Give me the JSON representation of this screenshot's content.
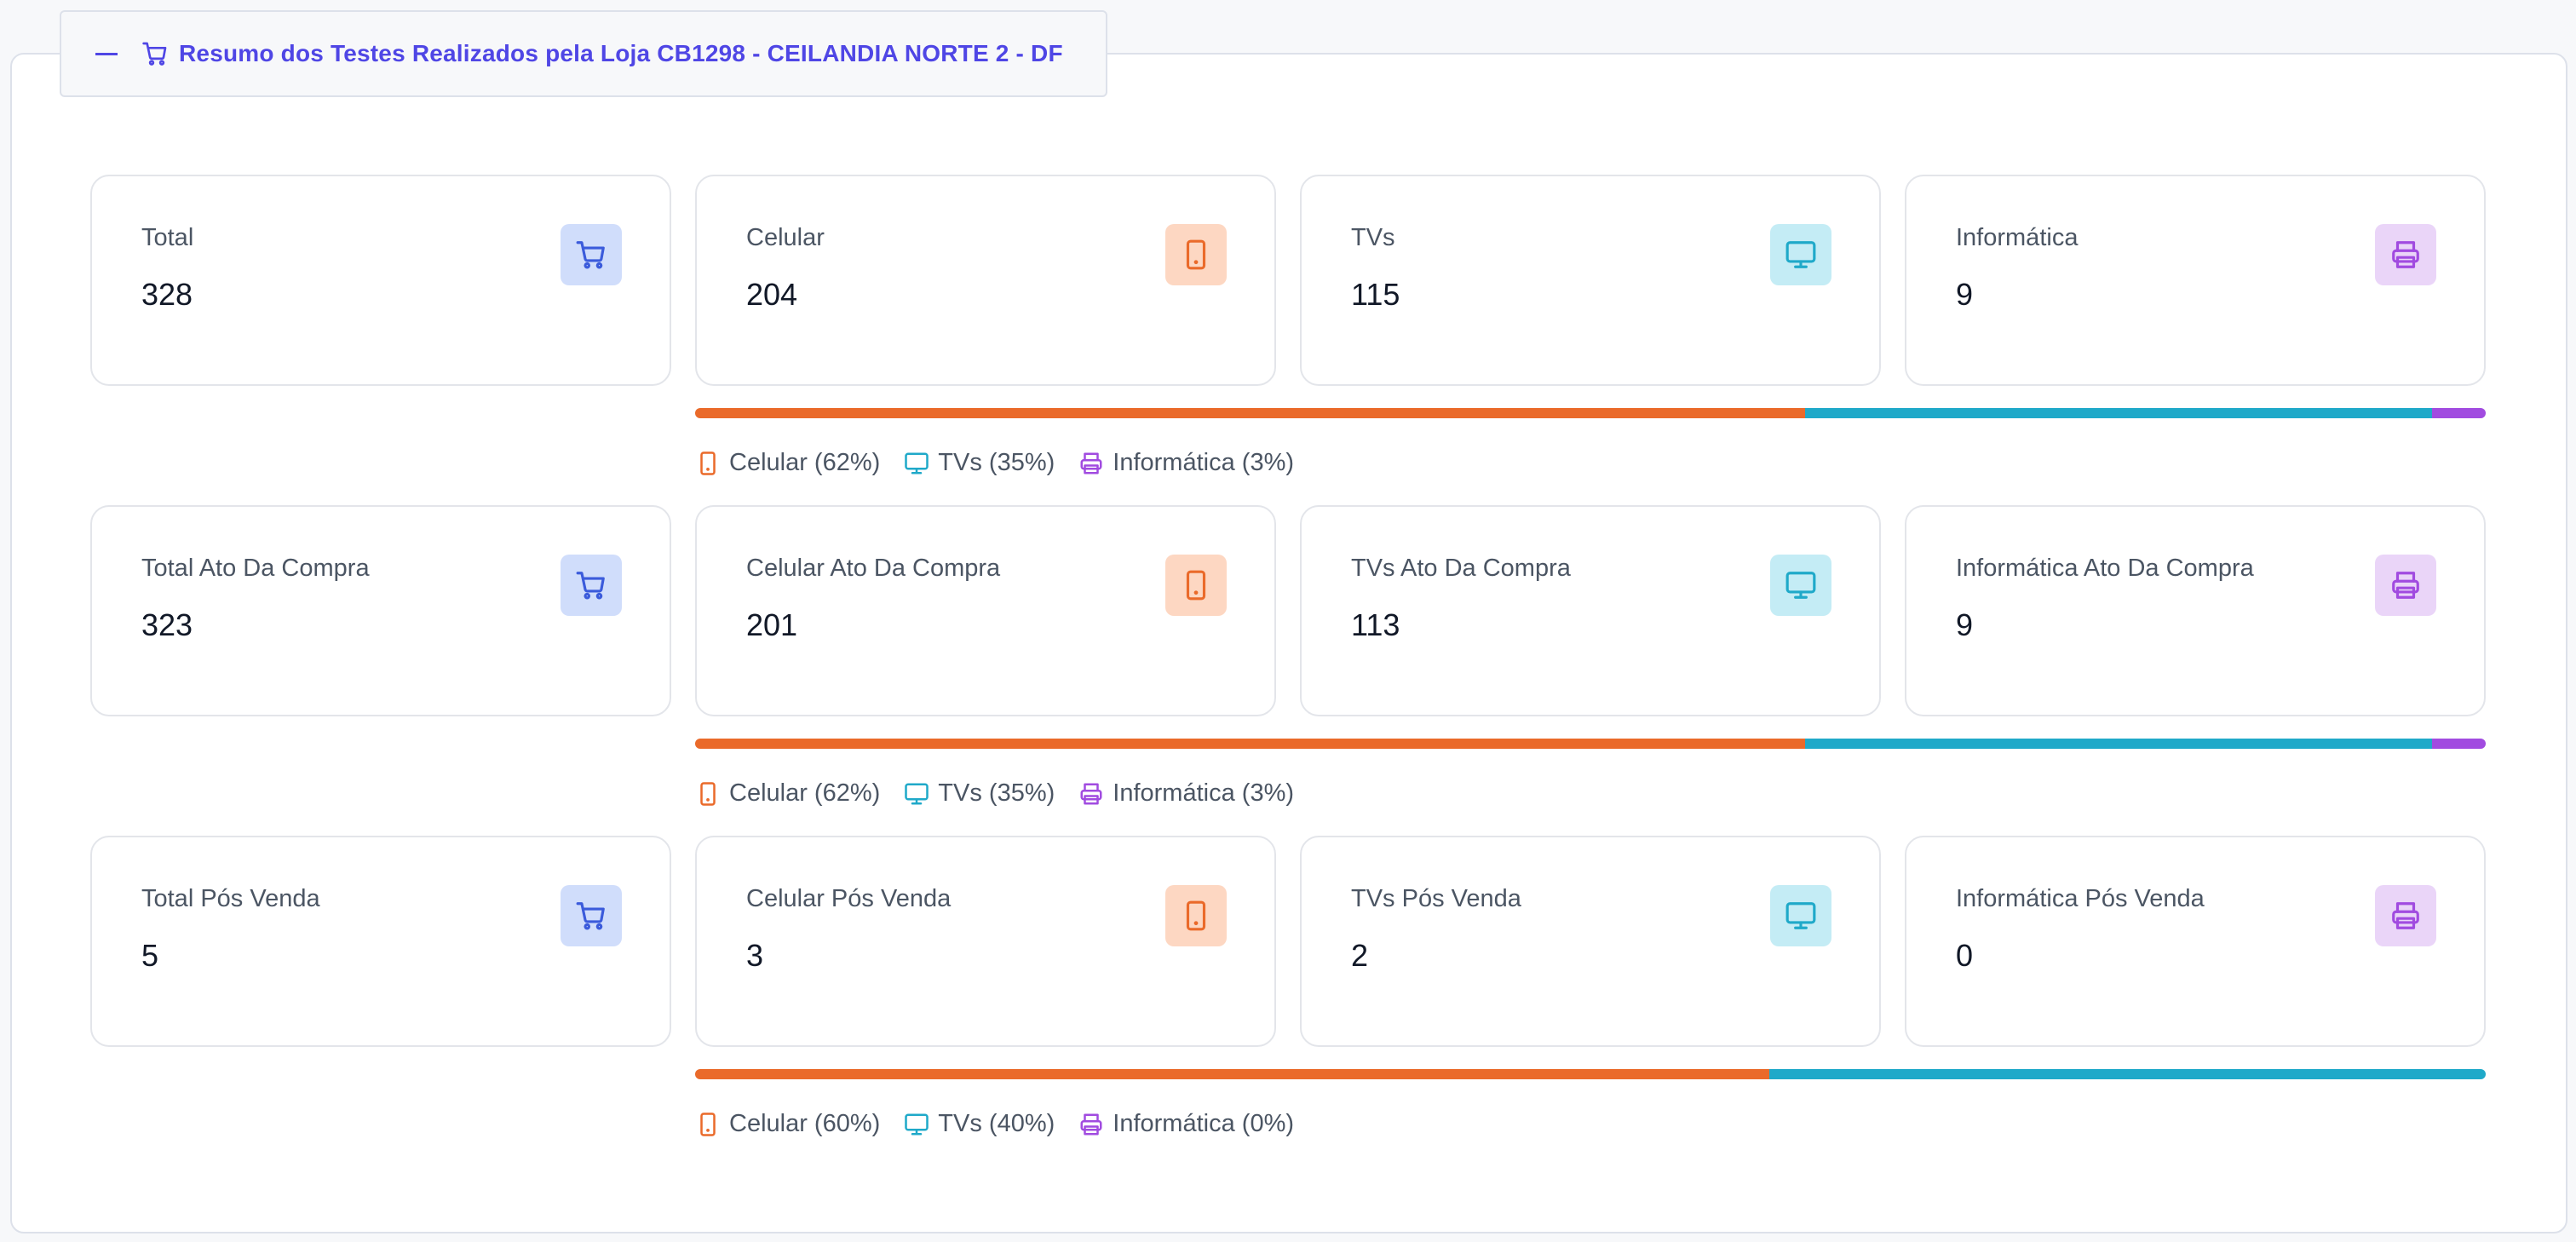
{
  "header": {
    "title": "Resumo dos Testes Realizados pela Loja CB1298 - CEILANDIA NORTE 2 - DF"
  },
  "colors": {
    "accent": "#4f46e5",
    "total": "#3b5bdb",
    "total_bg": "#d0ddfb",
    "celular": "#ea6a2a",
    "celular_bg": "#fdd7c2",
    "tvs": "#1fa9c9",
    "tvs_bg": "#c4ecf5",
    "informatica": "#a14be0",
    "informatica_bg": "#ead5f8"
  },
  "icons": {
    "total": "shopping-cart-icon",
    "celular": "smartphone-icon",
    "tvs": "monitor-icon",
    "informatica": "printer-icon"
  },
  "sections": [
    {
      "cards": [
        {
          "label": "Total",
          "value": "328"
        },
        {
          "label": "Celular",
          "value": "204"
        },
        {
          "label": "TVs",
          "value": "115"
        },
        {
          "label": "Informática",
          "value": "9"
        }
      ],
      "distribution": {
        "celular": 62,
        "tvs": 35,
        "informatica": 3
      },
      "legend": [
        "Celular (62%)",
        "TVs (35%)",
        "Informática (3%)"
      ]
    },
    {
      "cards": [
        {
          "label": "Total Ato Da Compra",
          "value": "323"
        },
        {
          "label": "Celular Ato Da Compra",
          "value": "201"
        },
        {
          "label": "TVs Ato Da Compra",
          "value": "113"
        },
        {
          "label": "Informática Ato Da Compra",
          "value": "9"
        }
      ],
      "distribution": {
        "celular": 62,
        "tvs": 35,
        "informatica": 3
      },
      "legend": [
        "Celular (62%)",
        "TVs (35%)",
        "Informática (3%)"
      ]
    },
    {
      "cards": [
        {
          "label": "Total Pós Venda",
          "value": "5"
        },
        {
          "label": "Celular Pós Venda",
          "value": "3"
        },
        {
          "label": "TVs Pós Venda",
          "value": "2"
        },
        {
          "label": "Informática Pós Venda",
          "value": "0"
        }
      ],
      "distribution": {
        "celular": 60,
        "tvs": 40,
        "informatica": 0
      },
      "legend": [
        "Celular (60%)",
        "TVs (40%)",
        "Informática (0%)"
      ]
    }
  ]
}
